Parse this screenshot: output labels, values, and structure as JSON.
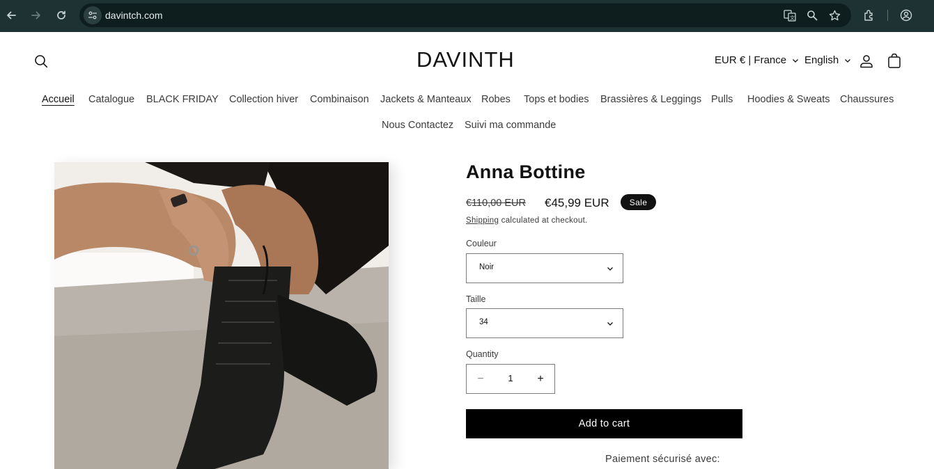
{
  "browser": {
    "url": "davintch.com",
    "icons": [
      "back-icon",
      "forward-icon",
      "reload-icon",
      "site-info-icon",
      "translate-icon",
      "zoom-icon",
      "bookmark-star-icon",
      "extensions-icon",
      "profile-icon"
    ]
  },
  "header": {
    "logo": "DAVINTH",
    "currency": "EUR € | France",
    "language": "English"
  },
  "menu": {
    "items": [
      "Accueil",
      "Catalogue",
      "BLACK FRIDAY",
      "Collection hiver",
      "Combinaison",
      "Jackets & Manteaux",
      "Robes",
      "Tops et bodies",
      "Brassières & Leggings",
      "Pulls",
      "Hoodies & Sweats",
      "Chaussures",
      "Nous Contactez",
      "Suivi ma commande"
    ],
    "active": "Accueil"
  },
  "product": {
    "title": "Anna Bottine",
    "price_old": "€110,00 EUR",
    "price_new": "€45,99 EUR",
    "badge": "Sale",
    "shipping_link": "Shipping",
    "shipping_text": " calculated at checkout.",
    "color_label": "Couleur",
    "color_value": "Noir",
    "size_label": "Taille",
    "size_value": "34",
    "quantity_label": "Quantity",
    "quantity": "1",
    "decrease": "−",
    "increase": "+",
    "add_to_cart": "Add to cart",
    "secure_payment": "Paiement sécurisé avec:"
  },
  "colors": {
    "chrome_bg": "#1f3233",
    "omnibox_bg": "#0e1e1f",
    "button_bg": "#000000",
    "text": "#121212"
  }
}
